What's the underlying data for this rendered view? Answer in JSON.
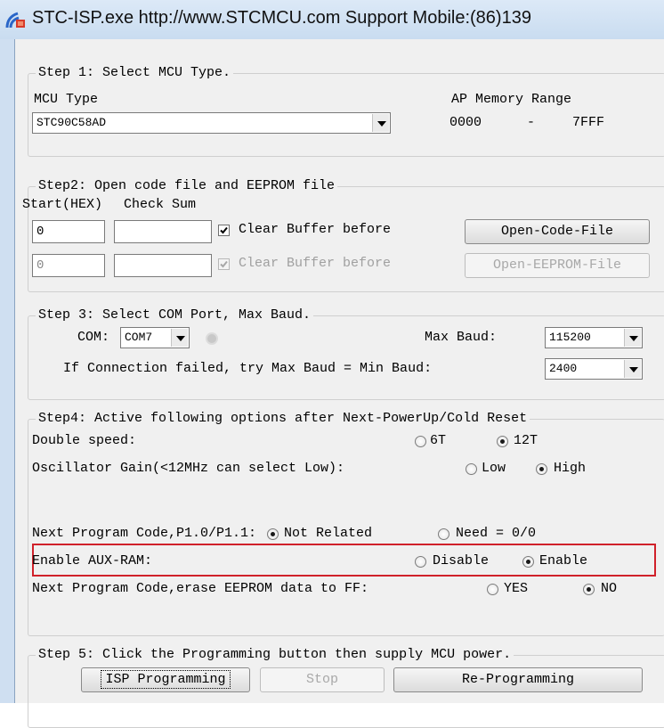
{
  "window": {
    "title": "STC-ISP.exe  http://www.STCMCU.com  Support Mobile:(86)139"
  },
  "step1": {
    "legend": "Step 1: Select MCU Type.",
    "mcu_type_label": "MCU Type",
    "mcu_type_value": "STC90C58AD",
    "ap_memory_label": "AP Memory Range",
    "range_start": "0000",
    "range_sep": "-",
    "range_end": "7FFF"
  },
  "step2": {
    "legend": "Step2: Open code file and EEPROM file",
    "start_hex_label": "Start(HEX)",
    "check_sum_label": "Check Sum",
    "code_start": "0",
    "code_checksum": "",
    "code_clear_buffer_label": "Clear Buffer before",
    "code_clear_buffer_checked": true,
    "open_code_button": "Open-Code-File",
    "eeprom_start": "0",
    "eeprom_checksum": "",
    "eeprom_clear_buffer_label": "Clear Buffer before",
    "eeprom_clear_buffer_checked": true,
    "open_eeprom_button": "Open-EEPROM-File"
  },
  "step3": {
    "legend": "Step 3: Select COM Port, Max Baud.",
    "com_label": "COM:",
    "com_value": "COM7",
    "max_baud_label": "Max Baud:",
    "max_baud_value": "115200",
    "min_baud_label": "If Connection failed, try Max Baud = Min Baud:",
    "min_baud_value": "2400"
  },
  "step4": {
    "legend": "Step4: Active following options after Next-PowerUp/Cold Reset",
    "double_speed_label": "Double speed:",
    "double_speed_options": [
      "6T",
      "12T"
    ],
    "double_speed_selected": "12T",
    "osc_gain_label": "Oscillator Gain(<12MHz can select Low):",
    "osc_gain_options": [
      "Low",
      "High"
    ],
    "osc_gain_selected": "High",
    "p10_label": "Next Program Code,P1.0/P1.1:",
    "p10_options": [
      "Not Related",
      "Need = 0/0"
    ],
    "p10_selected": "Not Related",
    "aux_ram_label": "Enable AUX-RAM:",
    "aux_ram_options": [
      "Disable",
      "Enable"
    ],
    "aux_ram_selected": "Enable",
    "erase_eeprom_label": "Next Program Code,erase EEPROM data to FF:",
    "erase_eeprom_options": [
      "YES",
      "NO"
    ],
    "erase_eeprom_selected": "NO",
    "highlight_color": "#d0212a"
  },
  "step5": {
    "legend": "Step 5: Click the Programming button then supply MCU power.",
    "isp_button": "ISP Programming",
    "stop_button": "Stop",
    "reprogram_button": "Re-Programming"
  }
}
